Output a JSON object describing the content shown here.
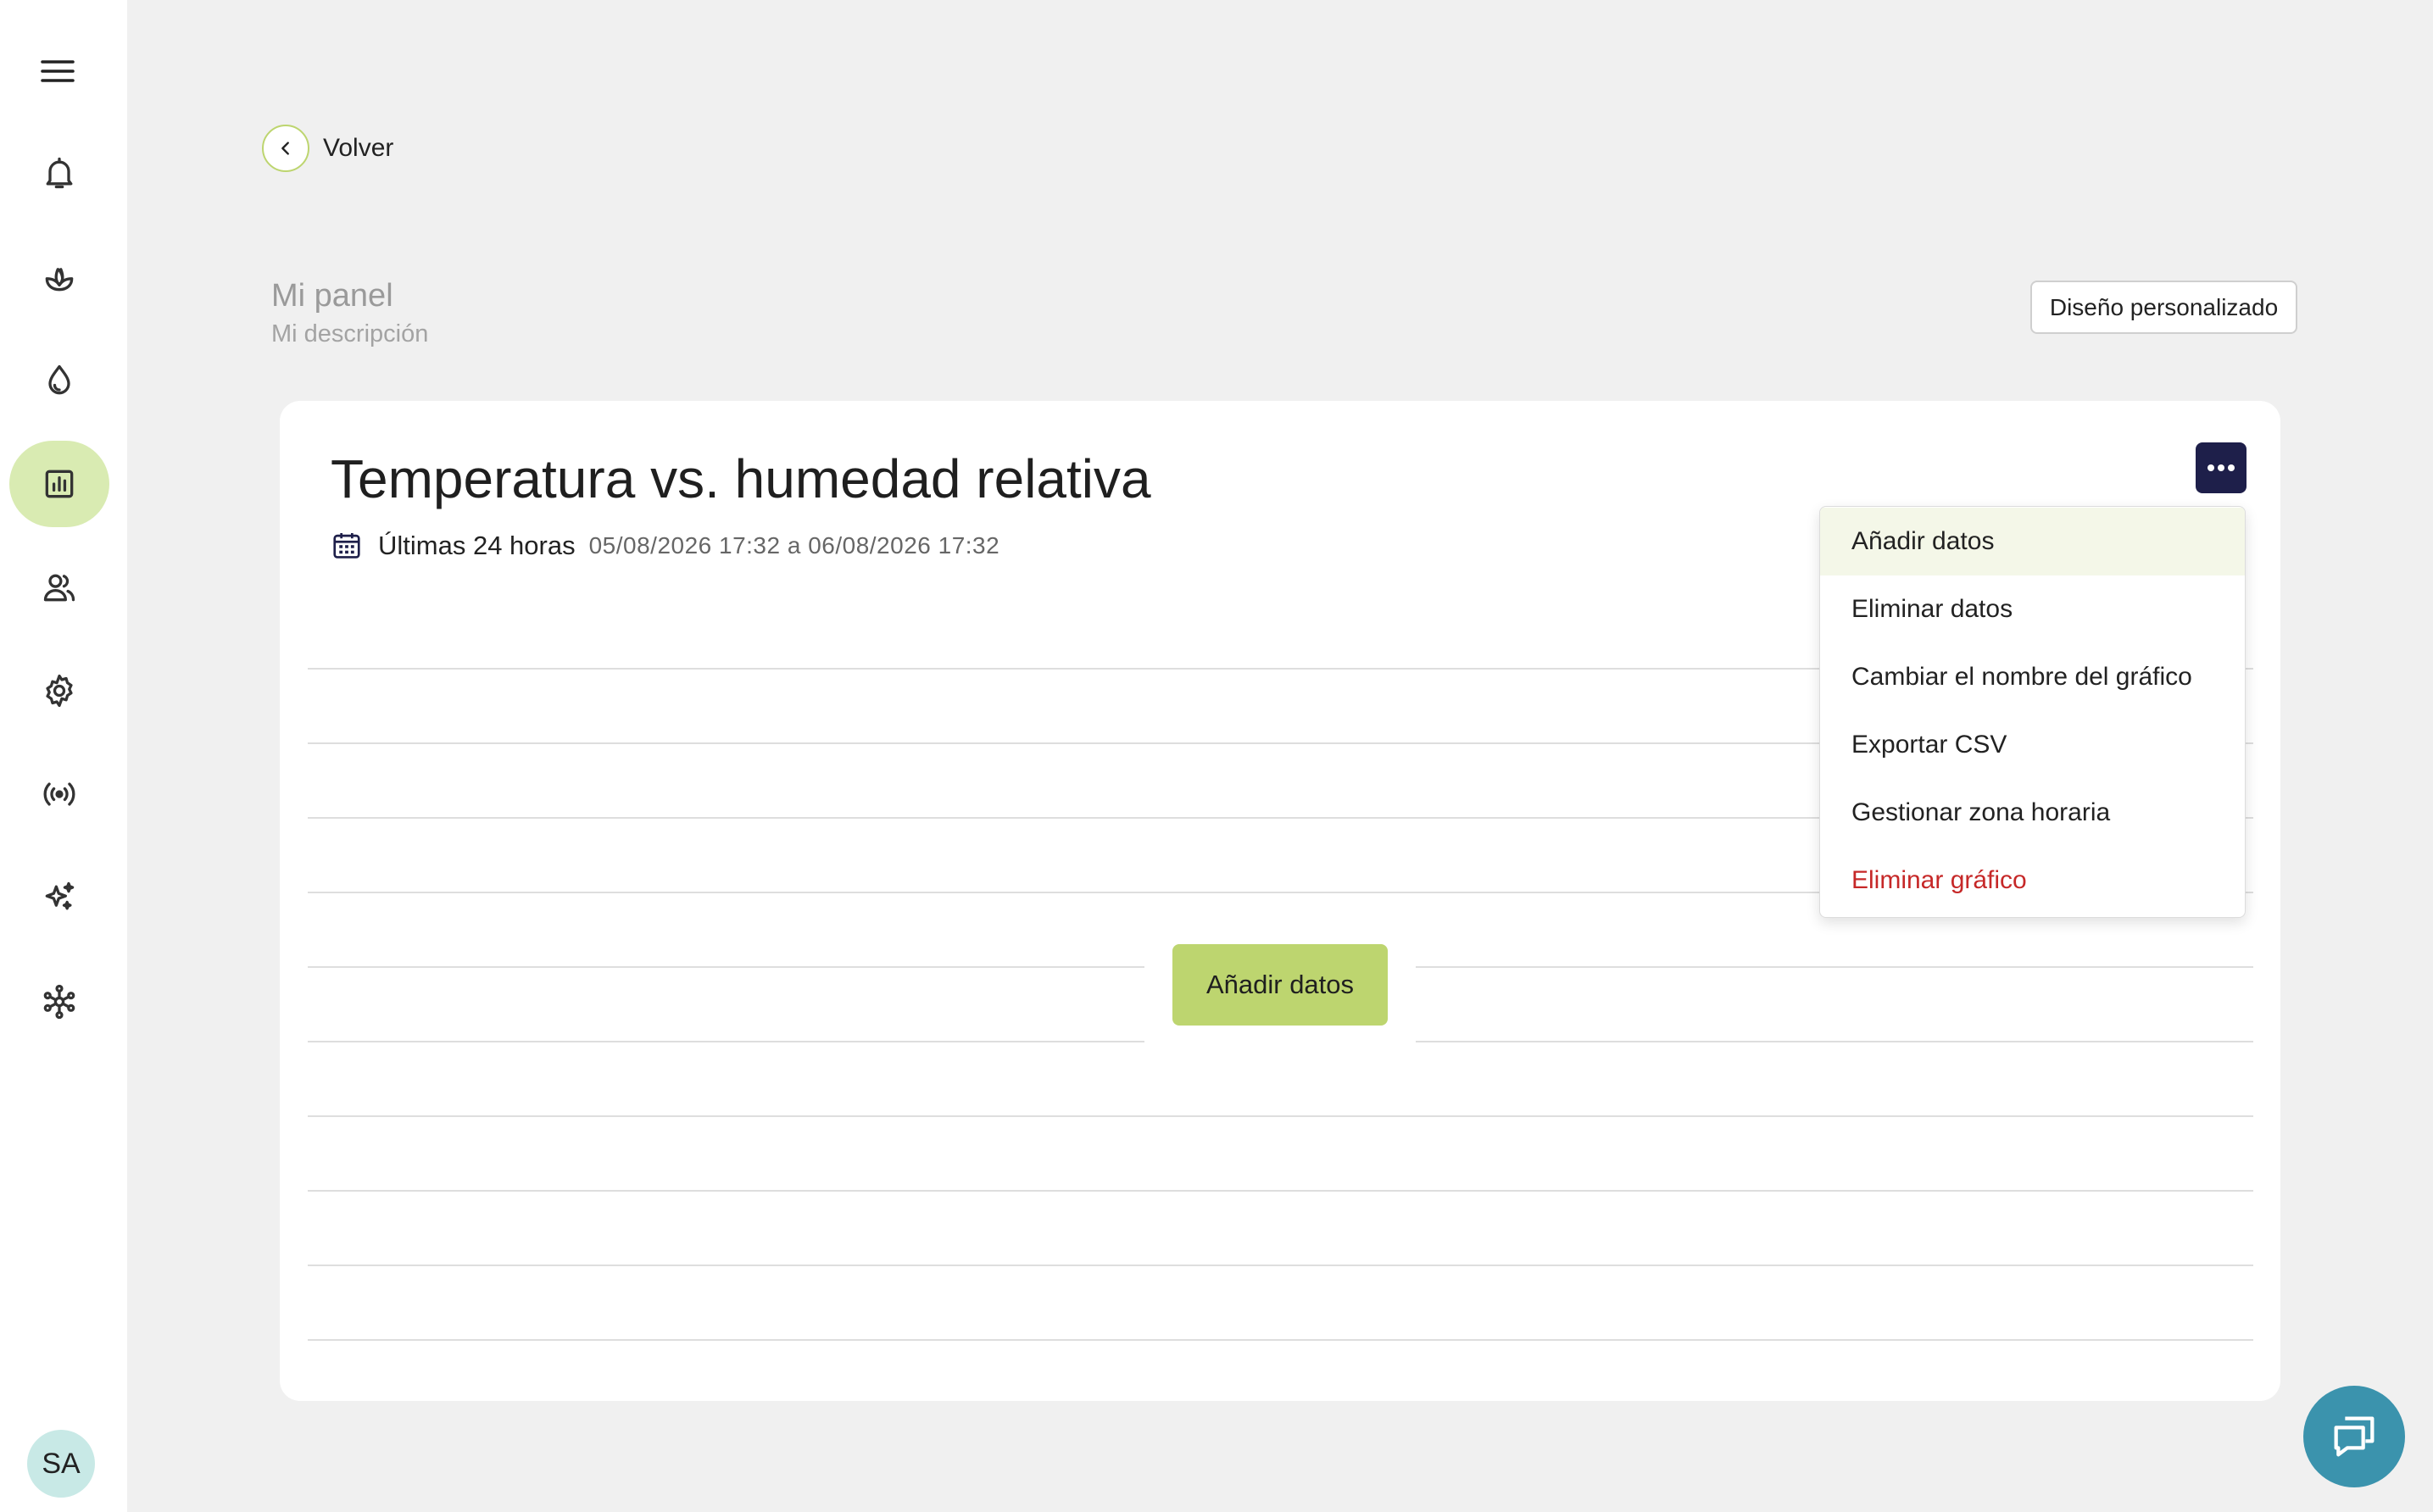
{
  "sidebar": {
    "avatar_initials": "SA",
    "items": [
      {
        "icon": "bell-icon"
      },
      {
        "icon": "plant-icon"
      },
      {
        "icon": "water-drop-icon"
      },
      {
        "icon": "bar-chart-icon",
        "active": true
      },
      {
        "icon": "users-icon"
      },
      {
        "icon": "gear-icon"
      },
      {
        "icon": "broadcast-icon"
      },
      {
        "icon": "sparkles-icon"
      },
      {
        "icon": "network-icon"
      }
    ]
  },
  "back": {
    "label": "Volver"
  },
  "panel": {
    "title": "Mi panel",
    "description": "Mi descripción",
    "layout_button": "Diseño personalizado"
  },
  "chart": {
    "title": "Temperatura vs. humedad relativa",
    "range_label": "Últimas 24 horas",
    "range_dates": "05/08/2026 17:32 a 06/08/2026 17:32",
    "add_data_button": "Añadir datos"
  },
  "menu": {
    "items": [
      {
        "label": "Añadir datos"
      },
      {
        "label": "Eliminar datos"
      },
      {
        "label": "Cambiar el nombre del gráfico"
      },
      {
        "label": "Exportar CSV"
      },
      {
        "label": "Gestionar zona horaria"
      },
      {
        "label": "Eliminar gráfico"
      }
    ]
  },
  "colors": {
    "accent": "#bdd56f",
    "active_nav": "#d9ebb2",
    "more_button": "#1e1f4a",
    "danger": "#c62828",
    "chat_fab": "#3b93ad"
  }
}
